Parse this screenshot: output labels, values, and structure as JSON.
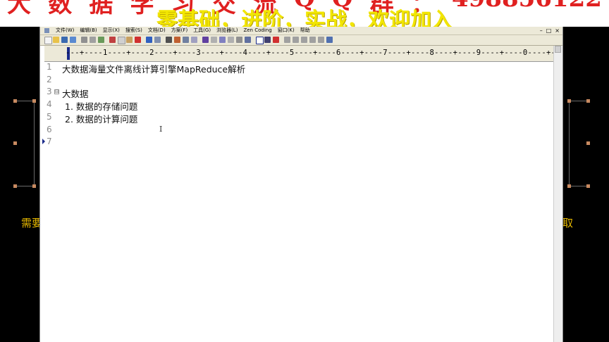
{
  "banner": {
    "line1": [
      "大",
      "数",
      "据",
      "学",
      "习",
      "交",
      "流",
      "Q",
      "Q",
      "群",
      "：",
      "498856122"
    ],
    "line2": "零基础，进阶，实战，欢迎加入"
  },
  "side": {
    "left_text": "需要",
    "right_text": "取"
  },
  "menubar": {
    "items": [
      "文件(W)",
      "编辑(B)",
      "显示(X)",
      "搜索(S)",
      "文档(D)",
      "方案(F)",
      "工具(G)",
      "浏览器(L)",
      "Zen Coding",
      "窗口(K)",
      "帮助"
    ],
    "window_buttons": [
      "–",
      "□",
      "×"
    ]
  },
  "ruler": {
    "text": "---+----1----+----2----+----3----+----4----+----5----+----6----+----7----+----8----+----9----+----0----+----1-"
  },
  "editor": {
    "lines": [
      {
        "num": "1",
        "text": "大数据海量文件离线计算引擎MapReduce解析"
      },
      {
        "num": "2",
        "text": ""
      },
      {
        "num": "3",
        "text": "大数据"
      },
      {
        "num": "4",
        "text": "1.  数据的存储问题"
      },
      {
        "num": "5",
        "text": "2.  数据的计算问题"
      },
      {
        "num": "6",
        "text": ""
      },
      {
        "num": "7",
        "text": ""
      }
    ],
    "fold_marker": "⊟",
    "cursor_glyph": "I"
  },
  "colors": {
    "banner_red": "#e02020",
    "banner_yellow": "#f2e600",
    "side_text": "#e6b800"
  }
}
